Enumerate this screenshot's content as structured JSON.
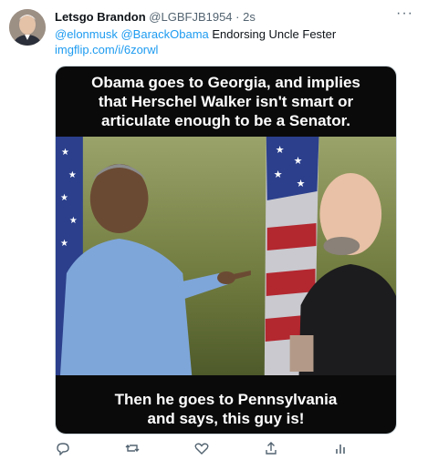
{
  "tweet": {
    "display_name": "Letsgo Brandon",
    "handle": "@LGBFJB1954",
    "separator": "·",
    "time": "2s",
    "more_label": "···",
    "mentions": [
      "@elonmusk",
      "@BarackObama"
    ],
    "text": "Endorsing Uncle Fester",
    "link": "imgflip.com/i/6zorwl"
  },
  "meme": {
    "top_caption": [
      "Obama goes to Georgia, and implies",
      "that Herschel Walker isn't smart or",
      "articulate enough to be a Senator."
    ],
    "bottom_caption": [
      "Then he goes to Pennsylvania",
      "and says, this guy is!"
    ]
  },
  "actions": [
    "reply-icon",
    "retweet-icon",
    "like-icon",
    "share-icon",
    "analytics-icon"
  ],
  "colors": {
    "link": "#1d9bf0",
    "secondary_text": "#536471",
    "meme_bg": "#0a0a0a"
  }
}
